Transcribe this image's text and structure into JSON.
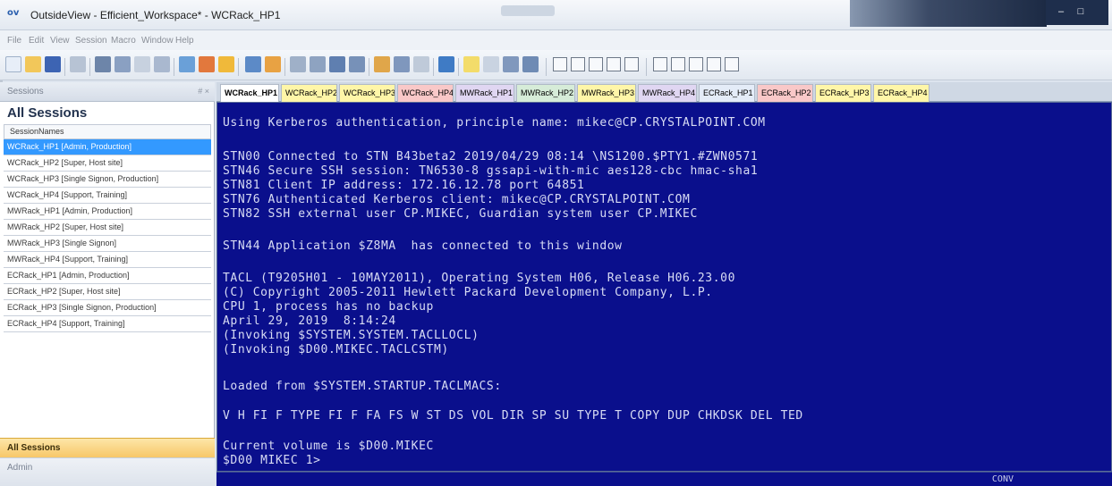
{
  "window": {
    "title": "OutsideView - Efficient_Workspace* - WCRack_HP1",
    "app_icon": "ov"
  },
  "menu": [
    "File",
    "Edit",
    "View",
    "Session",
    "Macro",
    "Window",
    "Help"
  ],
  "sidebar": {
    "header": "Sessions",
    "header_buttons": "# ×",
    "title": "All Sessions",
    "column_header": "SessionNames",
    "items": [
      "WCRack_HP1 [Admin, Production]",
      "WCRack_HP2 [Super, Host site]",
      "WCRack_HP3 [Single Signon, Production]",
      "WCRack_HP4 [Support, Training]",
      "MWRack_HP1 [Admin, Production]",
      "MWRack_HP2 [Super, Host site]",
      "MWRack_HP3 [Single Signon]",
      "MWRack_HP4 [Support, Training]",
      "ECRack_HP1 [Admin, Production]",
      "ECRack_HP2 [Super, Host site]",
      "ECRack_HP3 [Single Signon, Production]",
      "ECRack_HP4 [Support, Training]"
    ],
    "selected_index": 0,
    "footer_active": "All Sessions",
    "footer_second": "Admin"
  },
  "tabs": [
    {
      "label": "WCRack_HP1",
      "close": "×",
      "color": "#ffffff",
      "active": true
    },
    {
      "label": "WCRack_HP2",
      "color": "#fff6a8"
    },
    {
      "label": "WCRack_HP3",
      "color": "#fff6a8"
    },
    {
      "label": "WCRack_HP4",
      "color": "#f9c8c8"
    },
    {
      "label": "MWRack_HP1",
      "color": "#e0d6f2"
    },
    {
      "label": "MWRack_HP2",
      "color": "#d6ecd8"
    },
    {
      "label": "MWRack_HP3",
      "color": "#fff6a8"
    },
    {
      "label": "MWRack_HP4",
      "color": "#e0d6f2"
    },
    {
      "label": "ECRack_HP1",
      "color": "#e4ecf8"
    },
    {
      "label": "ECRack_HP2",
      "color": "#f9c8c8"
    },
    {
      "label": "ECRack_HP3",
      "color": "#fff6a8"
    },
    {
      "label": "ECRack_HP4",
      "color": "#fff6a8"
    }
  ],
  "terminal": {
    "lines": [
      "Using Kerberos authentication, principle name: mikec@CP.CRYSTALPOINT.COM",
      "",
      "STN00 Connected to STN B43beta2 2019/04/29 08:14 \\NS1200.$PTY1.#ZWN0571",
      "STN46 Secure SSH session: TN6530-8 gssapi-with-mic aes128-cbc hmac-sha1",
      "STN81 Client IP address: 172.16.12.78 port 64851",
      "STN76 Authenticated Kerberos client: mikec@CP.CRYSTALPOINT.COM",
      "STN82 SSH external user CP.MIKEC, Guardian system user CP.MIKEC",
      "",
      "STN44 Application $Z8MA  has connected to this window",
      "",
      "TACL (T9205H01 - 10MAY2011), Operating System H06, Release H06.23.00",
      "(C) Copyright 2005-2011 Hewlett Packard Development Company, L.P.",
      "CPU 1, process has no backup",
      "April 29, 2019  8:14:24",
      "(Invoking $SYSTEM.SYSTEM.TACLLOCL)",
      "(Invoking $D00.MIKEC.TACLCSTM)",
      "",
      "Loaded from $SYSTEM.STARTUP.TACLMACS:",
      "",
      "V H FI F TYPE FI F FA FS W ST DS VOL DIR SP SU TYPE T COPY DUP CHKDSK DEL TED",
      "",
      "Current volume is $D00.MIKEC",
      "$D00 MIKEC 1>"
    ],
    "status": "CONV"
  },
  "colors": {
    "terminal_bg": "#0a0f8c",
    "terminal_fg": "#d8dcf4",
    "selection": "#3399ff",
    "active_footer": "#f7c768"
  }
}
